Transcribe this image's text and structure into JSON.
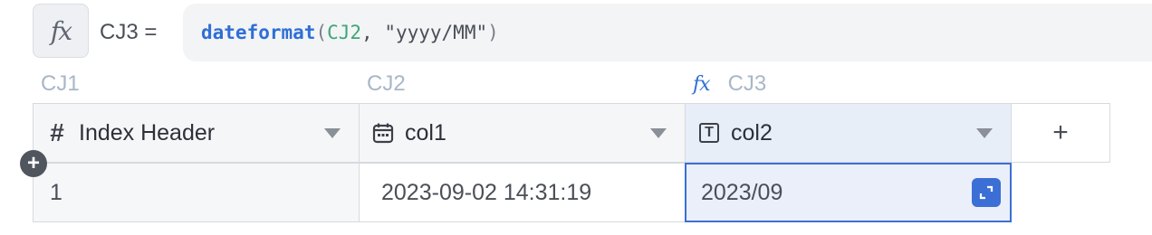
{
  "formula_bar": {
    "fx_icon": "fx-icon",
    "fx_glyph": "fx",
    "assign_label": "CJ3 =",
    "tokens": {
      "fn": "dateformat",
      "open": "(",
      "ref": "CJ2",
      "sep": ", ",
      "str": "\"yyyy/MM\"",
      "close": ")"
    }
  },
  "column_refs": {
    "c1": "CJ1",
    "c2": "CJ2",
    "c3_fx": "fx",
    "c3": "CJ3"
  },
  "headers": [
    {
      "icon": "hash-icon",
      "icon_glyph": "#",
      "label": "Index Header"
    },
    {
      "icon": "calendar-icon",
      "label": "col1"
    },
    {
      "icon": "text-type-icon",
      "icon_glyph": "T",
      "label": "col2"
    }
  ],
  "add_column": {
    "glyph": "+"
  },
  "add_row": {
    "glyph": "+"
  },
  "rows": [
    {
      "cells": [
        "1",
        "2023-09-02 14:31:19",
        "2023/09"
      ]
    }
  ],
  "colors": {
    "accent": "#3b6fd6",
    "function_token": "#2f6fd6",
    "reference_token": "#3ea67a"
  }
}
